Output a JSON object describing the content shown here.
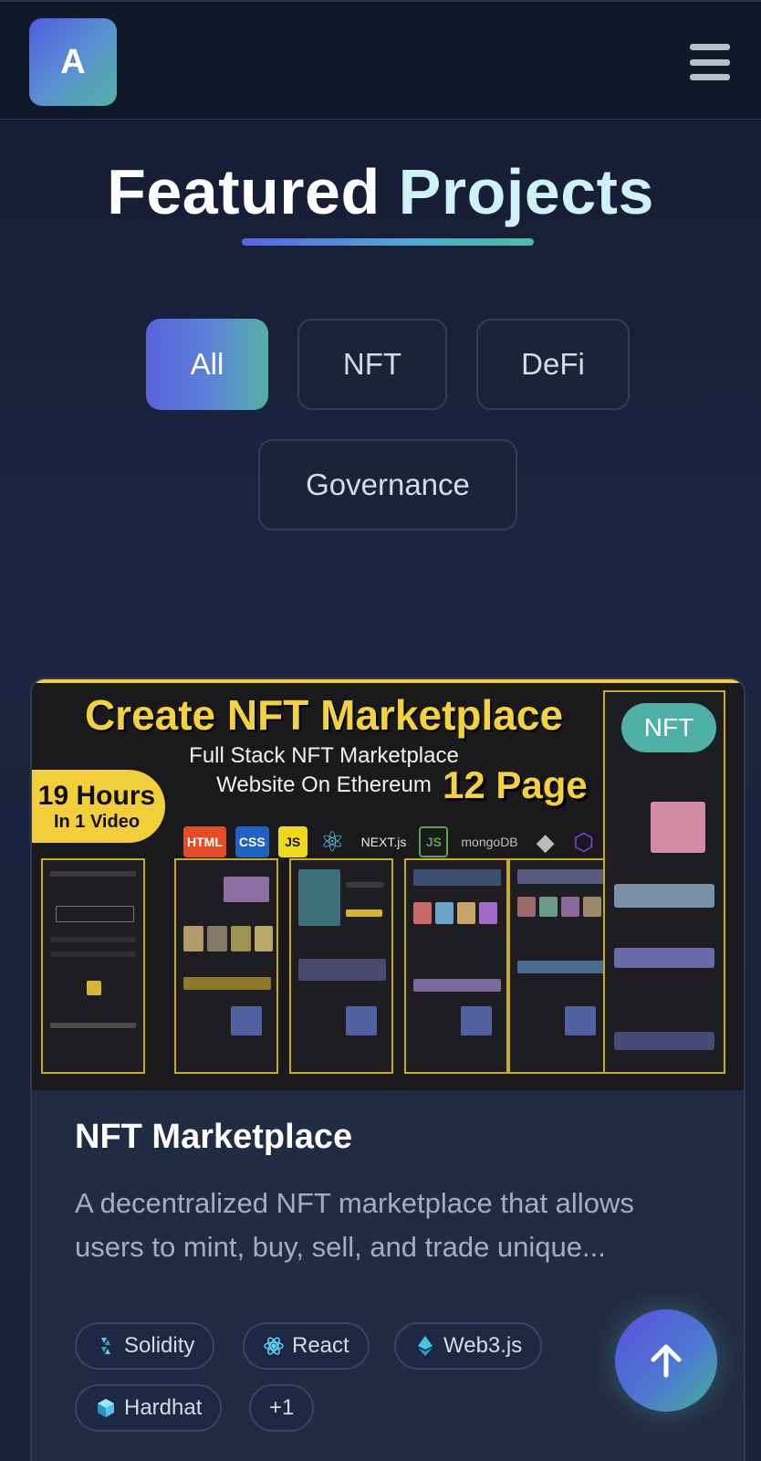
{
  "header": {
    "logo_letter": "A"
  },
  "page": {
    "title_part1": "Featured",
    "title_part2": "Projects"
  },
  "filters": {
    "active": "All",
    "items": [
      "All",
      "NFT",
      "DeFi",
      "Governance"
    ]
  },
  "project": {
    "category_badge": "NFT",
    "title": "NFT Marketplace",
    "description": "A decentralized NFT marketplace that allows users to mint, buy, sell, and trade unique...",
    "tags": [
      {
        "label": "Solidity",
        "icon": "solidity-icon"
      },
      {
        "label": "React",
        "icon": "react-icon"
      },
      {
        "label": "Web3.js",
        "icon": "ethereum-icon"
      },
      {
        "label": "Hardhat",
        "icon": "hardhat-icon"
      },
      {
        "label": "+1",
        "icon": ""
      }
    ],
    "thumbnail": {
      "headline": "Create NFT Marketplace",
      "subline_1": "Full Stack NFT Marketplace",
      "subline_2": "Website On Ethereum",
      "hours_big": "19 Hours",
      "hours_small": "In 1 Video",
      "pages": "12 Page",
      "tech_logos": [
        "HTML",
        "CSS",
        "JS",
        "React",
        "NEXT.js",
        "Node.js",
        "mongoDB",
        "Ethereum",
        "Polygon"
      ]
    }
  },
  "colors": {
    "accent_start": "#5a62de",
    "accent_end": "#55b0a5",
    "thumb_yellow": "#f3d23e",
    "badge": "#4fb0a5"
  },
  "controls": {
    "scroll_top_icon": "arrow-up-icon"
  }
}
